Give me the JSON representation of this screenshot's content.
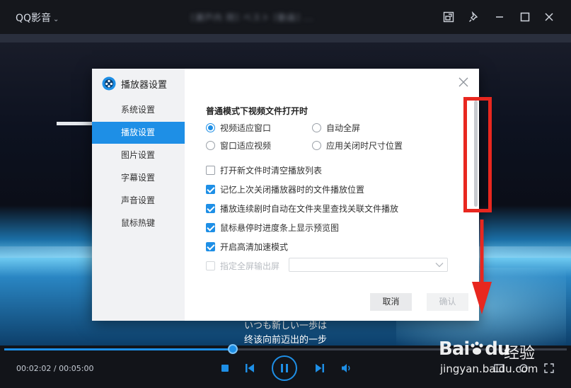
{
  "window": {
    "app_name": "QQ影音",
    "file_title": "[瀬戸内 岡] ベスト [動画] ...",
    "buttons": [
      "pin-window",
      "mini-mode",
      "minimize",
      "maximize",
      "close"
    ]
  },
  "subtitles": {
    "line1": "いつも新しい一歩は",
    "line2": "终该向前迈出的一步"
  },
  "player": {
    "current_time": "00:02:02",
    "total_time": "00:05:00",
    "time_display": "00:02:02 / 00:05:00",
    "progress_fraction": 0.4067,
    "accent": "#1e8fe6"
  },
  "dialog": {
    "title": "播放器设置",
    "sidebar": [
      {
        "label": "系统设置",
        "active": false
      },
      {
        "label": "播放设置",
        "active": true
      },
      {
        "label": "图片设置",
        "active": false
      },
      {
        "label": "字幕设置",
        "active": false
      },
      {
        "label": "声音设置",
        "active": false
      },
      {
        "label": "鼠标热键",
        "active": false
      }
    ],
    "section_title": "普通模式下视频文件打开时",
    "radios": [
      {
        "label": "视频适应窗口",
        "checked": true
      },
      {
        "label": "自动全屏",
        "checked": false
      },
      {
        "label": "窗口适应视频",
        "checked": false
      },
      {
        "label": "应用关闭时尺寸位置",
        "checked": false
      }
    ],
    "checkboxes": [
      {
        "label": "打开新文件时清空播放列表",
        "checked": false,
        "disabled": false
      },
      {
        "label": "记忆上次关闭播放器时的文件播放位置",
        "checked": true,
        "disabled": false
      },
      {
        "label": "播放连续剧时自动在文件夹里查找关联文件播放",
        "checked": true,
        "disabled": false
      },
      {
        "label": "鼠标悬停时进度条上显示预览图",
        "checked": true,
        "disabled": false
      },
      {
        "label": "开启高清加速模式",
        "checked": true,
        "disabled": false
      },
      {
        "label": "指定全屏输出屏",
        "checked": false,
        "disabled": true
      }
    ],
    "screen_select_value": "",
    "cancel_label": "取消",
    "confirm_label": "确认"
  },
  "annotation": {
    "color": "#e8271f"
  },
  "watermark": {
    "brand": "Bai",
    "brand_du": "du",
    "jingyan": "经验",
    "url": "jingyan.baidu.com"
  }
}
